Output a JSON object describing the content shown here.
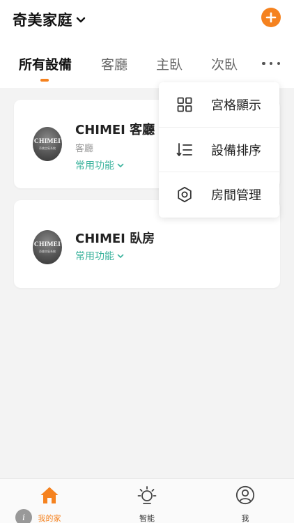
{
  "header": {
    "home_name": "奇美家庭",
    "add_icon": "plus-icon",
    "accent_color": "#f5821f"
  },
  "tabs": [
    {
      "label": "所有設備",
      "active": true
    },
    {
      "label": "客廳",
      "active": false
    },
    {
      "label": "主臥",
      "active": false
    },
    {
      "label": "次臥",
      "active": false
    }
  ],
  "more_icon": "more-horizontal-icon",
  "devices": [
    {
      "logo_text": "CHIMEI",
      "logo_sub": "奇美空氣系統",
      "name": "CHIMEI 客廳",
      "room": "客廳",
      "function_label": "常用功能"
    },
    {
      "logo_text": "CHIMEI",
      "logo_sub": "奇美空氣系統",
      "name": "CHIMEI 臥房",
      "function_label": "常用功能"
    }
  ],
  "popup_menu": [
    {
      "label": "宮格顯示",
      "icon": "grid-icon"
    },
    {
      "label": "設備排序",
      "icon": "sort-icon"
    },
    {
      "label": "房間管理",
      "icon": "gear-icon"
    }
  ],
  "bottom_nav": [
    {
      "label": "我的家",
      "icon": "home-icon",
      "active": true
    },
    {
      "label": "智能",
      "icon": "sun-icon",
      "active": false
    },
    {
      "label": "我",
      "icon": "user-icon",
      "active": false
    }
  ],
  "function_color": "#3bb39d"
}
